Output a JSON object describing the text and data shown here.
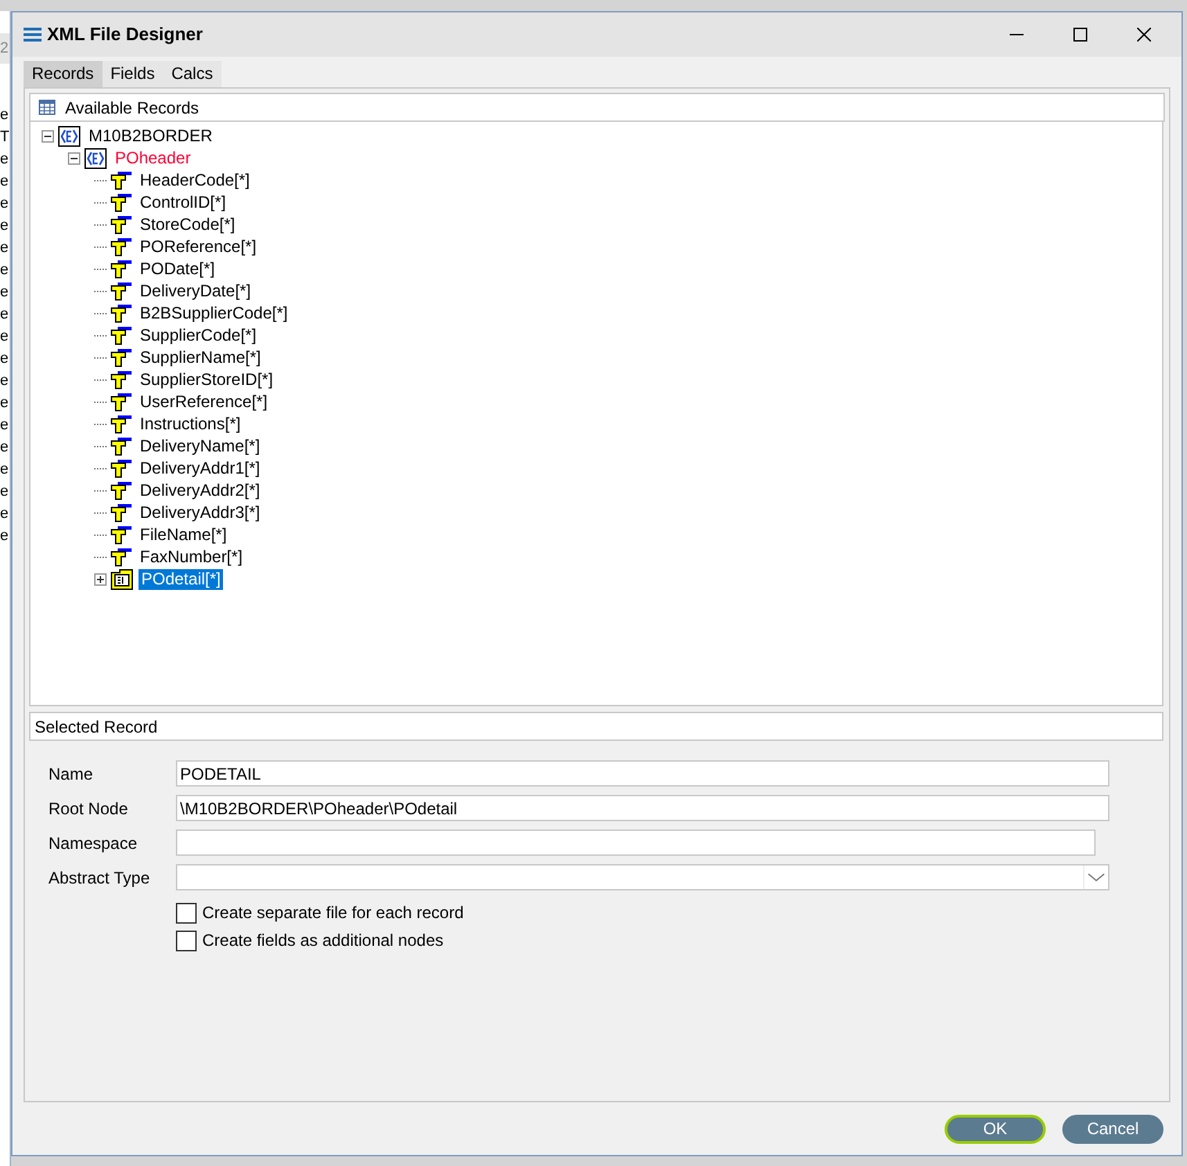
{
  "background_window": {
    "fragments": [
      {
        "text": "2",
        "kind": "box"
      },
      {
        "text": "e",
        "kind": "line"
      },
      {
        "text": "T",
        "kind": "line"
      },
      {
        "text": "e",
        "kind": "line"
      },
      {
        "text": "e",
        "kind": "line"
      },
      {
        "text": "e",
        "kind": "line"
      },
      {
        "text": "e",
        "kind": "line"
      },
      {
        "text": "e",
        "kind": "line"
      },
      {
        "text": "e",
        "kind": "line"
      },
      {
        "text": "e",
        "kind": "line"
      },
      {
        "text": "e",
        "kind": "line"
      },
      {
        "text": "e",
        "kind": "line"
      },
      {
        "text": "e",
        "kind": "line"
      },
      {
        "text": "e",
        "kind": "line"
      },
      {
        "text": "e",
        "kind": "line"
      },
      {
        "text": "e",
        "kind": "line"
      },
      {
        "text": "e",
        "kind": "line"
      },
      {
        "text": "e",
        "kind": "line"
      },
      {
        "text": "e",
        "kind": "line"
      },
      {
        "text": "e",
        "kind": "line"
      },
      {
        "text": "e",
        "kind": "line"
      }
    ]
  },
  "window": {
    "title": "XML File Designer"
  },
  "tabs": [
    {
      "label": "Records",
      "selected": true
    },
    {
      "label": "Fields",
      "selected": false
    },
    {
      "label": "Calcs",
      "selected": false
    }
  ],
  "records_panel": {
    "title": "Available Records"
  },
  "tree": [
    {
      "label": "M10B2BORDER",
      "kind": "element",
      "expanded": true,
      "selected": false,
      "children": [
        {
          "label": "POheader",
          "kind": "element",
          "expanded": true,
          "selected": false,
          "color": "#ff0033",
          "children": [
            {
              "label": "HeaderCode[*]",
              "kind": "field",
              "selected": false
            },
            {
              "label": "ControlID[*]",
              "kind": "field",
              "selected": false
            },
            {
              "label": "StoreCode[*]",
              "kind": "field",
              "selected": false
            },
            {
              "label": "POReference[*]",
              "kind": "field",
              "selected": false
            },
            {
              "label": "PODate[*]",
              "kind": "field",
              "selected": false
            },
            {
              "label": "DeliveryDate[*]",
              "kind": "field",
              "selected": false
            },
            {
              "label": "B2BSupplierCode[*]",
              "kind": "field",
              "selected": false
            },
            {
              "label": "SupplierCode[*]",
              "kind": "field",
              "selected": false
            },
            {
              "label": "SupplierName[*]",
              "kind": "field",
              "selected": false
            },
            {
              "label": "SupplierStoreID[*]",
              "kind": "field",
              "selected": false
            },
            {
              "label": "UserReference[*]",
              "kind": "field",
              "selected": false
            },
            {
              "label": "Instructions[*]",
              "kind": "field",
              "selected": false
            },
            {
              "label": "DeliveryName[*]",
              "kind": "field",
              "selected": false
            },
            {
              "label": "DeliveryAddr1[*]",
              "kind": "field",
              "selected": false
            },
            {
              "label": "DeliveryAddr2[*]",
              "kind": "field",
              "selected": false
            },
            {
              "label": "DeliveryAddr3[*]",
              "kind": "field",
              "selected": false
            },
            {
              "label": "FileName[*]",
              "kind": "field",
              "selected": false
            },
            {
              "label": "FaxNumber[*]",
              "kind": "field",
              "selected": false
            },
            {
              "label": "POdetail[*]",
              "kind": "record",
              "expanded": false,
              "selected": true
            }
          ]
        }
      ]
    }
  ],
  "selected_record": {
    "title": "Selected Record",
    "fields": [
      {
        "label": "Name",
        "kind": "text",
        "value": "PODETAIL"
      },
      {
        "label": "Root Node",
        "kind": "text",
        "value": "\\M10B2BORDER\\POheader\\POdetail"
      },
      {
        "label": "Namespace",
        "kind": "short"
      },
      {
        "label": "Abstract Type",
        "kind": "select"
      }
    ],
    "checkboxes": [
      {
        "label": "Create separate file for each record",
        "checked": false
      },
      {
        "label": "Create fields as additional nodes",
        "checked": false
      }
    ]
  },
  "buttons": [
    {
      "label": "OK",
      "default": true
    },
    {
      "label": "Cancel",
      "default": false
    }
  ]
}
